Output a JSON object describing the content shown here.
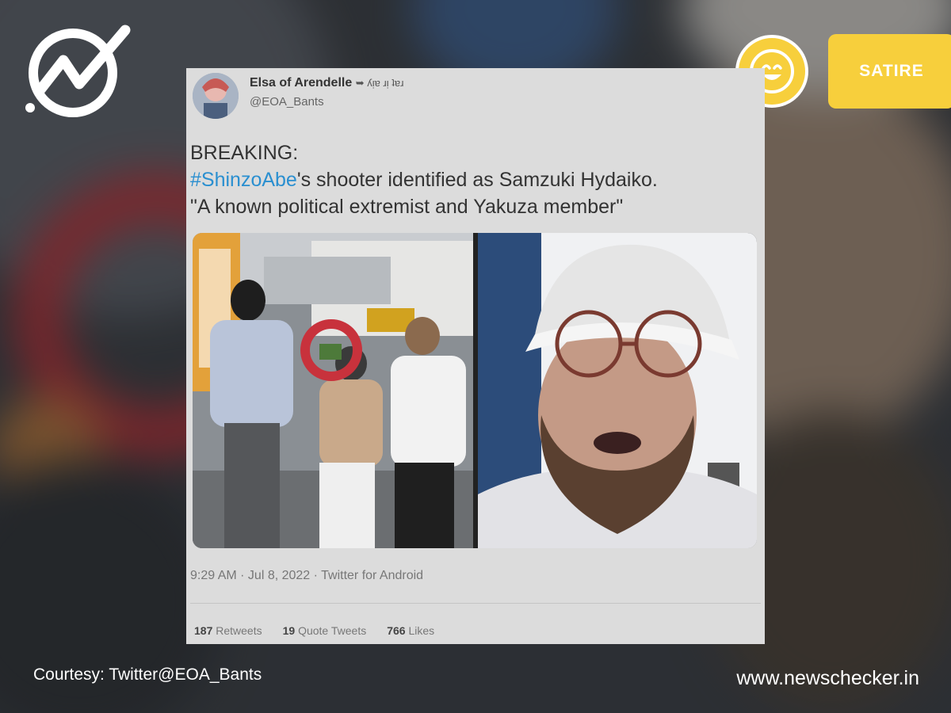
{
  "badge": {
    "label": "SATIRE",
    "icon": "smiley-icon",
    "color": "#f7cf3c"
  },
  "brand": {
    "logo": "newschecker-logo",
    "site": "www.newschecker.in"
  },
  "tweet": {
    "display_name": "Elsa of Arendelle",
    "display_name_suffix": "➥ ʎᴉɐ ɹᴉ ʇɐɹ",
    "handle": "@EOA_Bants",
    "line1": "BREAKING:",
    "hashtag": "#ShinzoAbe",
    "line2_rest": "'s shooter identified as Samzuki Hydaiko.",
    "line3": "\"A known political extremist and Yakuza member\"",
    "meta": "9:29 AM · Jul 8, 2022 · Twitter for Android",
    "stats": [
      {
        "count": "187",
        "label": "Retweets"
      },
      {
        "count": "19",
        "label": "Quote Tweets"
      },
      {
        "count": "766",
        "label": "Likes"
      }
    ],
    "hashtag_color": "#2a8fd0"
  },
  "courtesy": "Courtesy: Twitter@EOA_Bants"
}
